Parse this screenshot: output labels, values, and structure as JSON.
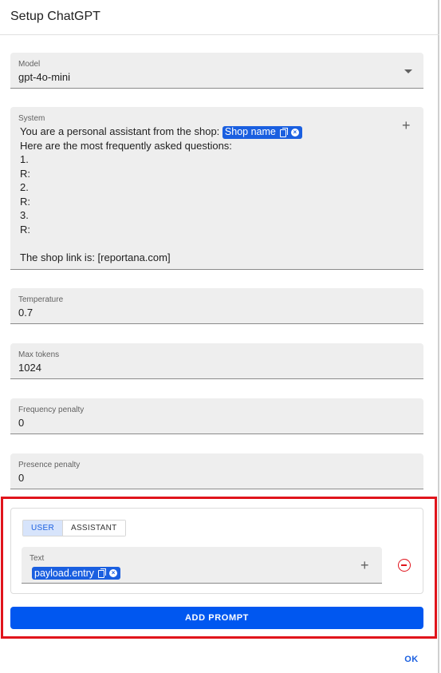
{
  "dialog": {
    "title": "Setup ChatGPT",
    "ok_label": "OK"
  },
  "model": {
    "label": "Model",
    "value": "gpt-4o-mini"
  },
  "system": {
    "label": "System",
    "line1_prefix": "You are a personal assistant from the shop: ",
    "line1_chip": "Shop name",
    "lines": [
      "Here are the most frequently asked questions:",
      "1.",
      "R:",
      "2.",
      "R:",
      "3.",
      "R:",
      "",
      "The shop link is: [reportana.com]"
    ]
  },
  "temperature": {
    "label": "Temperature",
    "value": "0.7"
  },
  "max_tokens": {
    "label": "Max tokens",
    "value": "1024"
  },
  "frequency_penalty": {
    "label": "Frequency penalty",
    "value": "0"
  },
  "presence_penalty": {
    "label": "Presence penalty",
    "value": "0"
  },
  "prompt": {
    "roles": [
      "USER",
      "ASSISTANT"
    ],
    "active_role": "USER",
    "text_label": "Text",
    "text_chip": "payload.entry",
    "add_prompt_label": "ADD PROMPT"
  },
  "colors": {
    "accent": "#0057f0",
    "chip": "#1a5fe0",
    "highlight": "#e0141c"
  },
  "icons": {
    "dropdown": "caret-down-icon",
    "add": "plus-icon",
    "copy": "copy-icon",
    "chip_remove": "close-circle-icon",
    "remove_prompt": "minus-circle-icon"
  }
}
